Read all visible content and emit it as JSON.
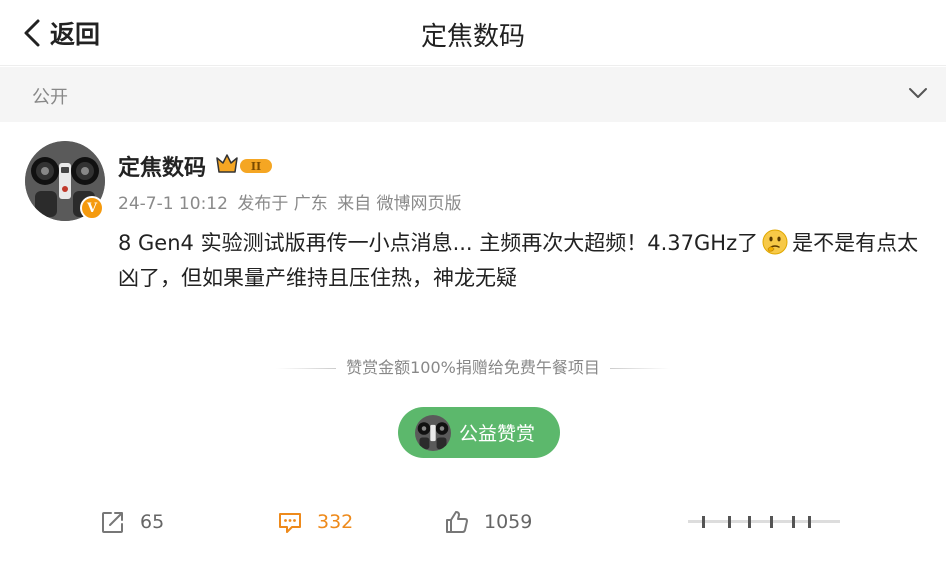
{
  "header": {
    "back_label": "返回",
    "title": "定焦数码"
  },
  "visibility": {
    "label": "公开"
  },
  "post": {
    "author": "定焦数码",
    "vip_badge": "II",
    "verified_badge": "V",
    "time": "24-7-1 10:12",
    "location": "发布于 广东",
    "source": "来自 微博网页版",
    "text_part1": "8 Gen4 实验测试版再传一小点消息... 主频再次大超频！4.37GHz了",
    "text_part2": "是不是有点太凶了，但如果量产维持且压住热，神龙无疑"
  },
  "reward": {
    "note": "赞赏金额100%捐赠给免费午餐项目",
    "button_label": "公益赞赏"
  },
  "actions": {
    "share_count": "65",
    "comment_count": "332",
    "like_count": "1059"
  },
  "colors": {
    "reward_green": "#5cb86c",
    "comment_orange": "#ee8a1b",
    "badge_gold": "#f5a623"
  }
}
